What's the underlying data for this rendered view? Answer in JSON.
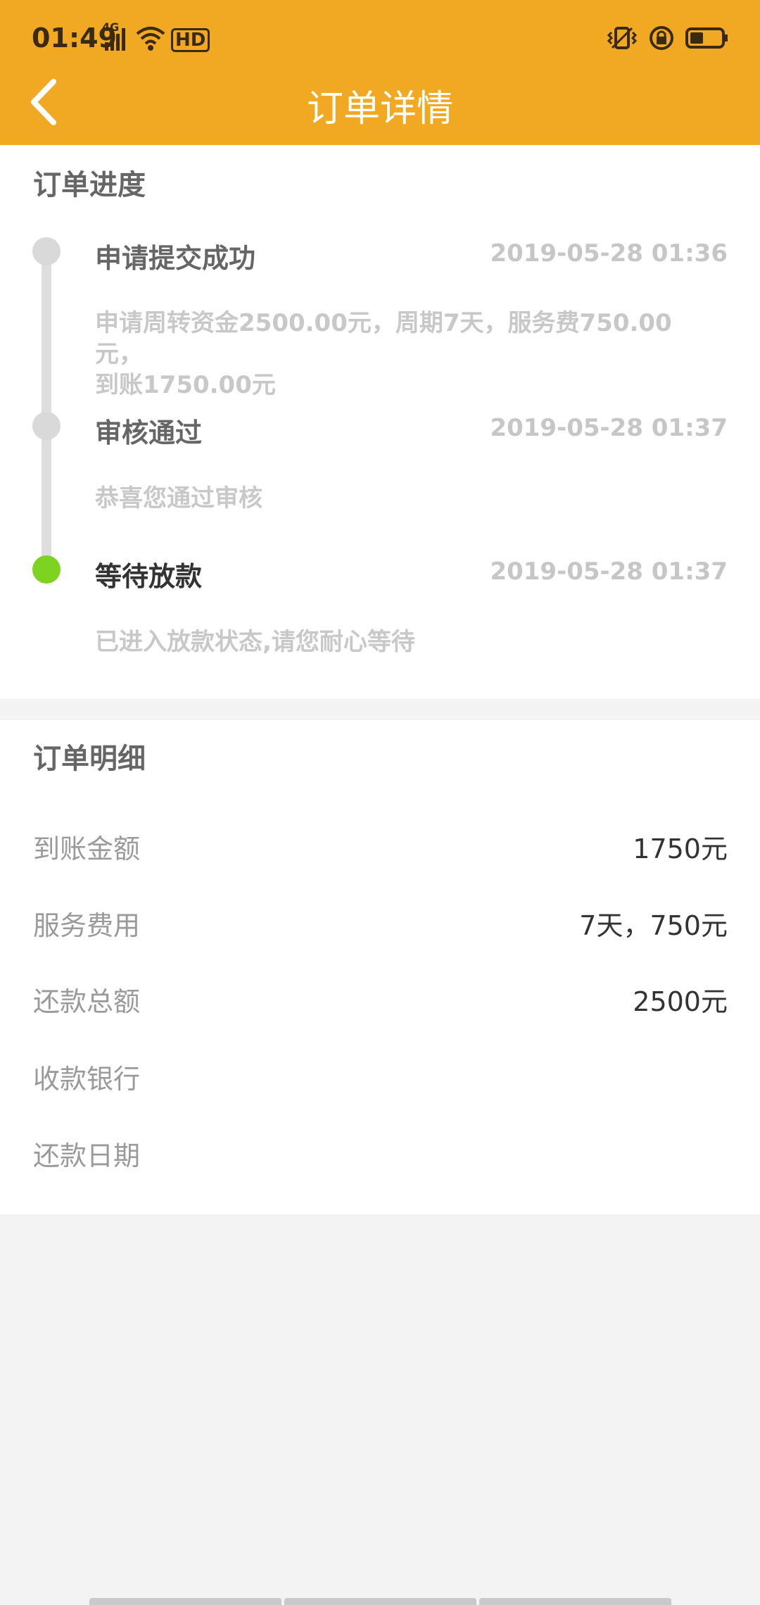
{
  "status_bar": {
    "time": "01:49",
    "network": "4G",
    "hd": "HD",
    "icons": [
      "signal-icon",
      "wifi-icon",
      "hd-icon",
      "vibrate-icon",
      "rotation-lock-icon",
      "battery-icon"
    ]
  },
  "header": {
    "title": "订单详情",
    "back_icon": "chevron-left-icon"
  },
  "progress": {
    "title": "订单进度",
    "steps": [
      {
        "title": "申请提交成功",
        "time": "2019-05-28 01:36",
        "desc_line1": "申请周转资金2500.00元，周期7天，服务费750.00元，",
        "desc_line2": "到账1750.00元",
        "status": "done"
      },
      {
        "title": "审核通过",
        "time": "2019-05-28 01:37",
        "desc_line1": "恭喜您通过审核",
        "status": "done"
      },
      {
        "title": "等待放款",
        "time": "2019-05-28 01:37",
        "desc_line1": "已进入放款状态,请您耐心等待",
        "status": "active"
      }
    ],
    "colors": {
      "done": "#d9d9d9",
      "active": "#7ed321"
    }
  },
  "detail": {
    "title": "订单明细",
    "rows": [
      {
        "label": "到账金额",
        "value": "1750元"
      },
      {
        "label": "服务费用",
        "value": "7天，750元"
      },
      {
        "label": "还款总额",
        "value": "2500元"
      },
      {
        "label": "收款银行",
        "value": ""
      },
      {
        "label": "还款日期",
        "value": ""
      }
    ]
  },
  "theme": {
    "accent": "#f1a823"
  }
}
